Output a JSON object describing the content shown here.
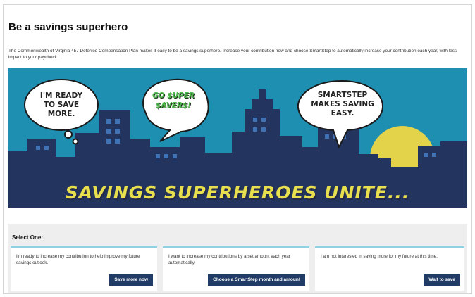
{
  "page": {
    "title": "Be a savings superhero",
    "intro": "The Commonwealth of Virginia 457 Deferred Compensation Plan makes it easy to be a savings superhero. Increase your contribution now and choose SmartStep to automatically increase your contribution each year, with less impact to your paycheck."
  },
  "banner": {
    "bubble_left": "I'M READY TO SAVE MORE.",
    "bubble_center": "GO $UPER $AVER$!",
    "bubble_right": "SMARTSTEP MAKES SAVING EASY.",
    "headline": "SAVINGS SUPERHEROES UNITE...",
    "colors": {
      "sky": "#1f8fb1",
      "city": "#23345e",
      "sun": "#e3d34a",
      "text": "#e8df4e"
    }
  },
  "selection": {
    "label": "Select One:",
    "options": [
      {
        "text": "I'm ready to increase my contribution to help improve my future savings outlook.",
        "button": "Save more now"
      },
      {
        "text": "I want to increase my contributions by a set amount each year automatically.",
        "button": "Choose a SmartStep month and amount"
      },
      {
        "text": "I am not interested in saving more for my future at this time.",
        "button": "Wait to save"
      }
    ]
  }
}
